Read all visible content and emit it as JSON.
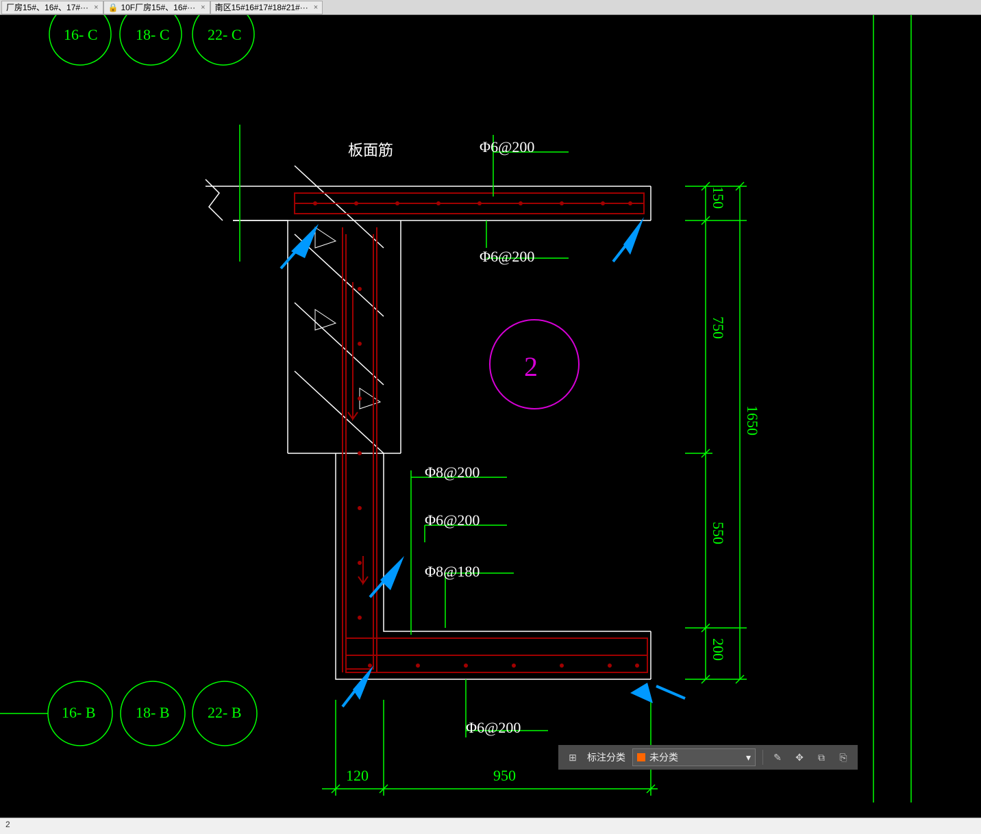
{
  "tabs": [
    {
      "label": "厂房15#、16#、17#···",
      "lock": false
    },
    {
      "label": "10F厂房15#、16#···",
      "lock": true
    },
    {
      "label": "南区15#16#17#18#21#···",
      "lock": false
    }
  ],
  "grid_bubbles_top": [
    "16- C",
    "18- C",
    "22- C"
  ],
  "grid_bubbles_bottom": [
    "16- B",
    "18- B",
    "22- B"
  ],
  "detail_number": "2",
  "annotations": {
    "top_label": "板面筋",
    "rebar1": "Φ6@200",
    "rebar2": "Φ6@200",
    "rebar3": "Φ8@200",
    "rebar4": "Φ6@200",
    "rebar5": "Φ8@180",
    "rebar6": "Φ6@200"
  },
  "dims_v": {
    "d1": "150",
    "d2": "750",
    "d3": "550",
    "d4": "200",
    "total": "1650"
  },
  "dims_h": {
    "d1": "120",
    "d2": "950"
  },
  "bottom_panel": {
    "classify_label": "标注分类",
    "dropdown_value": "未分类"
  },
  "status": {
    "coord": "2"
  }
}
